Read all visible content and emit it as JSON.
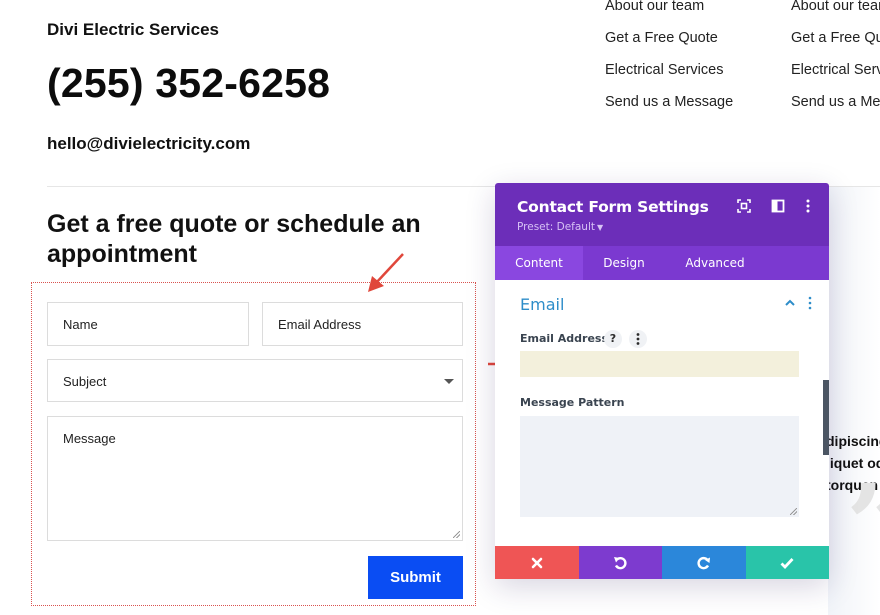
{
  "site": {
    "business_name": "Divi Electric Services",
    "phone": "(255) 352-6258",
    "email": "hello@divielectricity.com"
  },
  "nav_columns": [
    {
      "items": [
        "About our team",
        "Get a Free Quote",
        "Electrical Services",
        "Send us a Message"
      ]
    },
    {
      "items": [
        "About our team",
        "Get a Free Quote",
        "Electrical Services",
        "Send us a Message"
      ]
    }
  ],
  "section": {
    "heading": "Get a free quote or schedule an appointment"
  },
  "contact_form": {
    "name_placeholder": "Name",
    "email_placeholder": "Email Address",
    "subject_value": "Subject",
    "message_placeholder": "Message",
    "submit_label": "Submit"
  },
  "background_text": {
    "lines": [
      "dipiscing",
      "liquet od",
      "torquen"
    ],
    "quote_glyph": "”"
  },
  "settings_panel": {
    "title": "Contact Form Settings",
    "preset": "Preset: Default",
    "tabs": [
      "Content",
      "Design",
      "Advanced"
    ],
    "active_tab": "Content",
    "group_title": "Email",
    "email_address_label": "Email Address",
    "email_address_value": "",
    "help_glyph": "?",
    "message_pattern_label": "Message Pattern",
    "message_pattern_value": "",
    "footer_buttons": [
      "cancel",
      "undo",
      "redo",
      "save"
    ]
  },
  "colors": {
    "panel_header": "#6c2eb9",
    "panel_tabs": "#7b39d0",
    "active_tab": "#8a47e0",
    "group_title": "#2e8dc9",
    "submit": "#0a4df3",
    "cancel": "#ef5555",
    "undo": "#7d3bcf",
    "redo": "#2b87da",
    "save": "#29c4a9",
    "annotation_arrow": "#e0473b"
  }
}
